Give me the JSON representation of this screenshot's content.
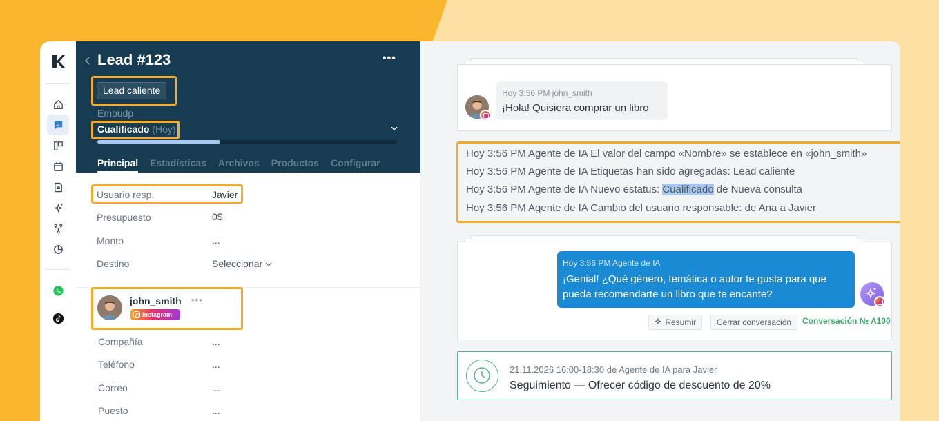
{
  "lead": {
    "title": "Lead #123",
    "more": "•••",
    "tag": "Lead caliente",
    "pipeline": "Embudp",
    "status": "Cualificado",
    "status_when": "(Hoy)",
    "progress": 0.41,
    "tabs": [
      "Principal",
      "Estadísticas",
      "Archivos",
      "Productos",
      "Configurar"
    ],
    "fields": [
      {
        "label": "Usuario resp.",
        "value": "Javier"
      },
      {
        "label": "Presupuesto",
        "value": "0$"
      },
      {
        "label": "Monto",
        "value": "..."
      },
      {
        "label": "Destino",
        "value": "Seleccionar"
      }
    ],
    "contact": {
      "name": "john_smith",
      "more": "•••",
      "channel": "Instagram",
      "fields": [
        {
          "label": "Compañía",
          "value": "..."
        },
        {
          "label": "Teléfono",
          "value": "..."
        },
        {
          "label": "Correo",
          "value": "..."
        },
        {
          "label": "Puesto",
          "value": "..."
        }
      ]
    }
  },
  "chat": {
    "incoming": {
      "meta": "Hoy 3:56 PM john_smith",
      "text": "¡Hola! Quisiera comprar un libro"
    },
    "log": [
      "Hoy 3:56 PM Agente de IA El valor del campo «Nombre» se establece en «john_smith»",
      "Hoy 3:56 PM Agente de IA Etiquetas han sido agregadas: Lead caliente"
    ],
    "log_status": {
      "before": "Hoy 3:56 PM Agente de IA Nuevo estatus: ",
      "highlight": "Cualificado",
      "after": " de Nueva consulta"
    },
    "log_last": "Hoy 3:56 PM Agente de IA Cambio del usuario responsable: de Ana a Javier",
    "outgoing": {
      "meta": "Hoy 3:56 PM Agente de IA",
      "text": "¡Genial! ¿Qué género, temática o autor te gusta para que pueda recomendarte un libro que te encante?"
    },
    "summarize_label": "Resumir",
    "close_label": "Cerrar conversación",
    "conversation_link": "Conversación № A100",
    "task": {
      "meta_date": "21.11.2026 16:00-18:30",
      "meta_rest": " de Agente de IA para Javier",
      "text": "Seguimiento — Ofrecer código de descuento de 20%"
    }
  },
  "colors": {
    "accent_orange": "#f5ab2a",
    "header_navy": "#173c52",
    "bubble_blue": "#1a8ad4",
    "success_green": "#3aa86b"
  }
}
